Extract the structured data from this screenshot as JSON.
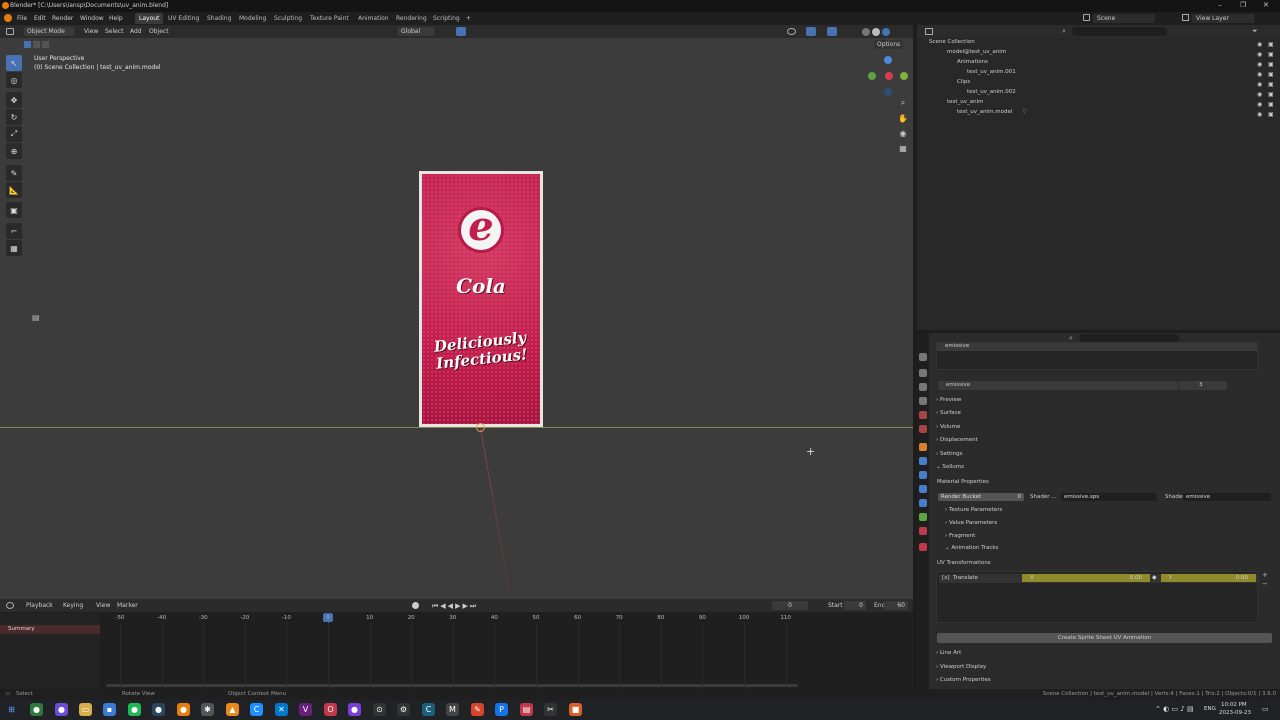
{
  "window": {
    "title": "Blender* [C:\\Users\\iansp\\Documents\\uv_anim.blend]",
    "controls": [
      "–",
      "❐",
      "✕"
    ]
  },
  "menubar": {
    "items": [
      "File",
      "Edit",
      "Render",
      "Window",
      "Help"
    ],
    "workspaces": [
      "Layout",
      "UV Editing",
      "Shading",
      "Modeling",
      "Sculpting",
      "Texture Paint",
      "Animation",
      "Rendering",
      "Scripting"
    ],
    "add_tab": "+",
    "scene": "Scene",
    "view_layer": "View Layer"
  },
  "viewport": {
    "mode": "Object Mode",
    "menus": [
      "View",
      "Select",
      "Add",
      "Object"
    ],
    "transform": "Global",
    "options": "Options",
    "overlay_title": "User Perspective",
    "overlay_subtitle": "(0) Scene Collection | test_uv_anim.model",
    "poster": {
      "logo": "e",
      "brand": "Cola",
      "slogan_1": "Deliciously",
      "slogan_2": "Infectious!"
    }
  },
  "timeline": {
    "menus": [
      "Playback",
      "Keying",
      "View",
      "Marker"
    ],
    "current_frame": "0",
    "start_label": "Start",
    "start": "0",
    "end_label": "End",
    "end": "60",
    "summary": "Summary",
    "ticks": [
      "-50",
      "-40",
      "-30",
      "-20",
      "-10",
      "0",
      "10",
      "20",
      "30",
      "40",
      "50",
      "60",
      "70",
      "80",
      "90",
      "100",
      "110"
    ]
  },
  "outliner": {
    "rows": [
      {
        "label": "Scene Collection"
      },
      {
        "label": "model@test_uv_anim"
      },
      {
        "label": "Animations"
      },
      {
        "label": "test_uv_anim.001"
      },
      {
        "label": "Clips"
      },
      {
        "label": "test_uv_anim.002"
      },
      {
        "label": "test_uv_anim"
      },
      {
        "label": "test_uv_anim.model"
      }
    ]
  },
  "properties": {
    "slot": "emissive",
    "material": "emissive",
    "users": "3",
    "sections": [
      "Preview",
      "Surface",
      "Volume",
      "Displacement",
      "Settings",
      "Sollumz"
    ],
    "material_properties": "Material Properties",
    "render_bucket_label": "Render Bucket",
    "render_bucket": "0",
    "shader_label_1": "Shader ...",
    "shader_value_1": "emissive.sps",
    "shader_label_2": "Shader ...",
    "shader_value_2": "emissive",
    "subsections": [
      "Texture Parameters",
      "Value Parameters",
      "Fragment",
      "Animation Tracks"
    ],
    "uv_transformations": "UV Transformations",
    "translate_label": "Translate",
    "x_label": "X",
    "x_value": "0.00",
    "y_label": "Y",
    "y_value": "0.00",
    "create_button": "Create Sprite Sheet UV Animation",
    "bottom_sections": [
      "Line Art",
      "Viewport Display",
      "Custom Properties"
    ]
  },
  "statusbar": {
    "select": "Select",
    "rotate": "Rotate View",
    "context": "Object Context Menu",
    "info": "Scene Collection | test_uv_anim.model | Verts:4 | Faces:1 | Tris:2 | Objects:0/1 | 3.6.0"
  },
  "taskbar": {
    "lang": "ENG",
    "time": "10:02 PM",
    "date": "2023-09-23"
  },
  "colors": {
    "accent": "#4772b3",
    "poster_red": "#c11d4c",
    "field_yellow": "#8f8a2c"
  }
}
